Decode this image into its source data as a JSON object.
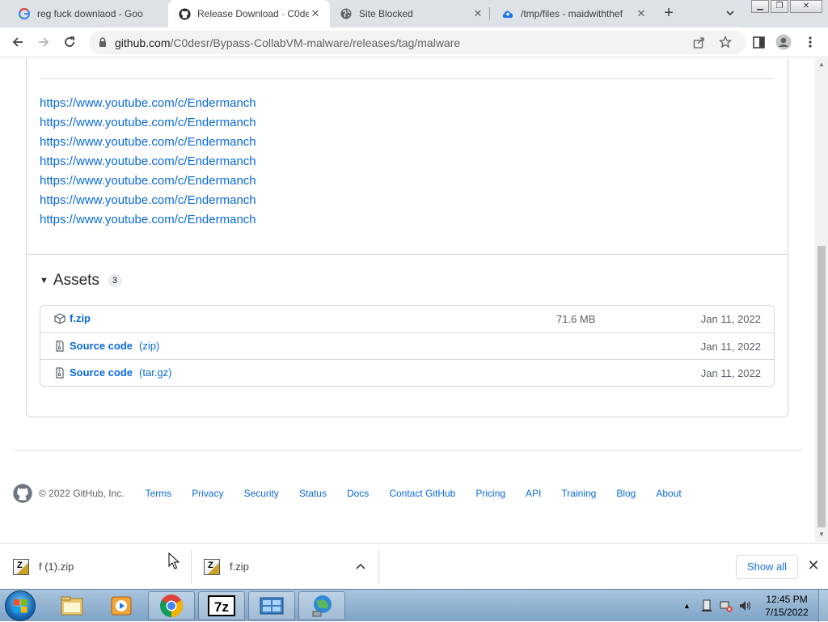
{
  "browser": {
    "tabs": [
      {
        "title": "reg fuck downlaod - Goo",
        "favicon": "google-icon",
        "active": false
      },
      {
        "title": "Release Download · C0de",
        "favicon": "github-icon",
        "active": true
      },
      {
        "title": "Site Blocked",
        "favicon": "globe-icon",
        "active": false
      },
      {
        "title": "/tmp/files - maidwiththef",
        "favicon": "cloud-upload-icon",
        "active": false
      }
    ],
    "new_tab_label": "+",
    "url_domain": "github.com",
    "url_path": "/C0desr/Bypass-CollabVM-malware/releases/tag/malware"
  },
  "release": {
    "links": [
      "https://www.youtube.com/c/Endermanch",
      "https://www.youtube.com/c/Endermanch",
      "https://www.youtube.com/c/Endermanch",
      "https://www.youtube.com/c/Endermanch",
      "https://www.youtube.com/c/Endermanch",
      "https://www.youtube.com/c/Endermanch",
      "https://www.youtube.com/c/Endermanch"
    ],
    "assets_title": "Assets",
    "assets_count": "3",
    "assets": [
      {
        "name": "f.zip",
        "ext": "",
        "size": "71.6 MB",
        "date": "Jan 11, 2022",
        "icon": "package-icon"
      },
      {
        "name": "Source code",
        "ext": "(zip)",
        "size": "",
        "date": "Jan 11, 2022",
        "icon": "file-zip-icon"
      },
      {
        "name": "Source code",
        "ext": "(tar.gz)",
        "size": "",
        "date": "Jan 11, 2022",
        "icon": "file-zip-icon"
      }
    ]
  },
  "footer": {
    "copyright": "© 2022 GitHub, Inc.",
    "links": [
      "Terms",
      "Privacy",
      "Security",
      "Status",
      "Docs",
      "Contact GitHub",
      "Pricing",
      "API",
      "Training",
      "Blog",
      "About"
    ]
  },
  "downloads": {
    "items": [
      {
        "filename": "f (1).zip"
      },
      {
        "filename": "f.zip"
      }
    ],
    "show_all": "Show all"
  },
  "taskbar": {
    "time": "12:45 PM",
    "date": "7/15/2022",
    "apps": [
      "explorer-icon",
      "media-player-icon",
      "chrome-icon",
      "7zip-icon",
      "control-panel-icon",
      "network-globe-icon"
    ]
  },
  "colors": {
    "link": "#0969da",
    "tabstrip": "#dee1e6",
    "taskbar": "#7ea3c6"
  }
}
